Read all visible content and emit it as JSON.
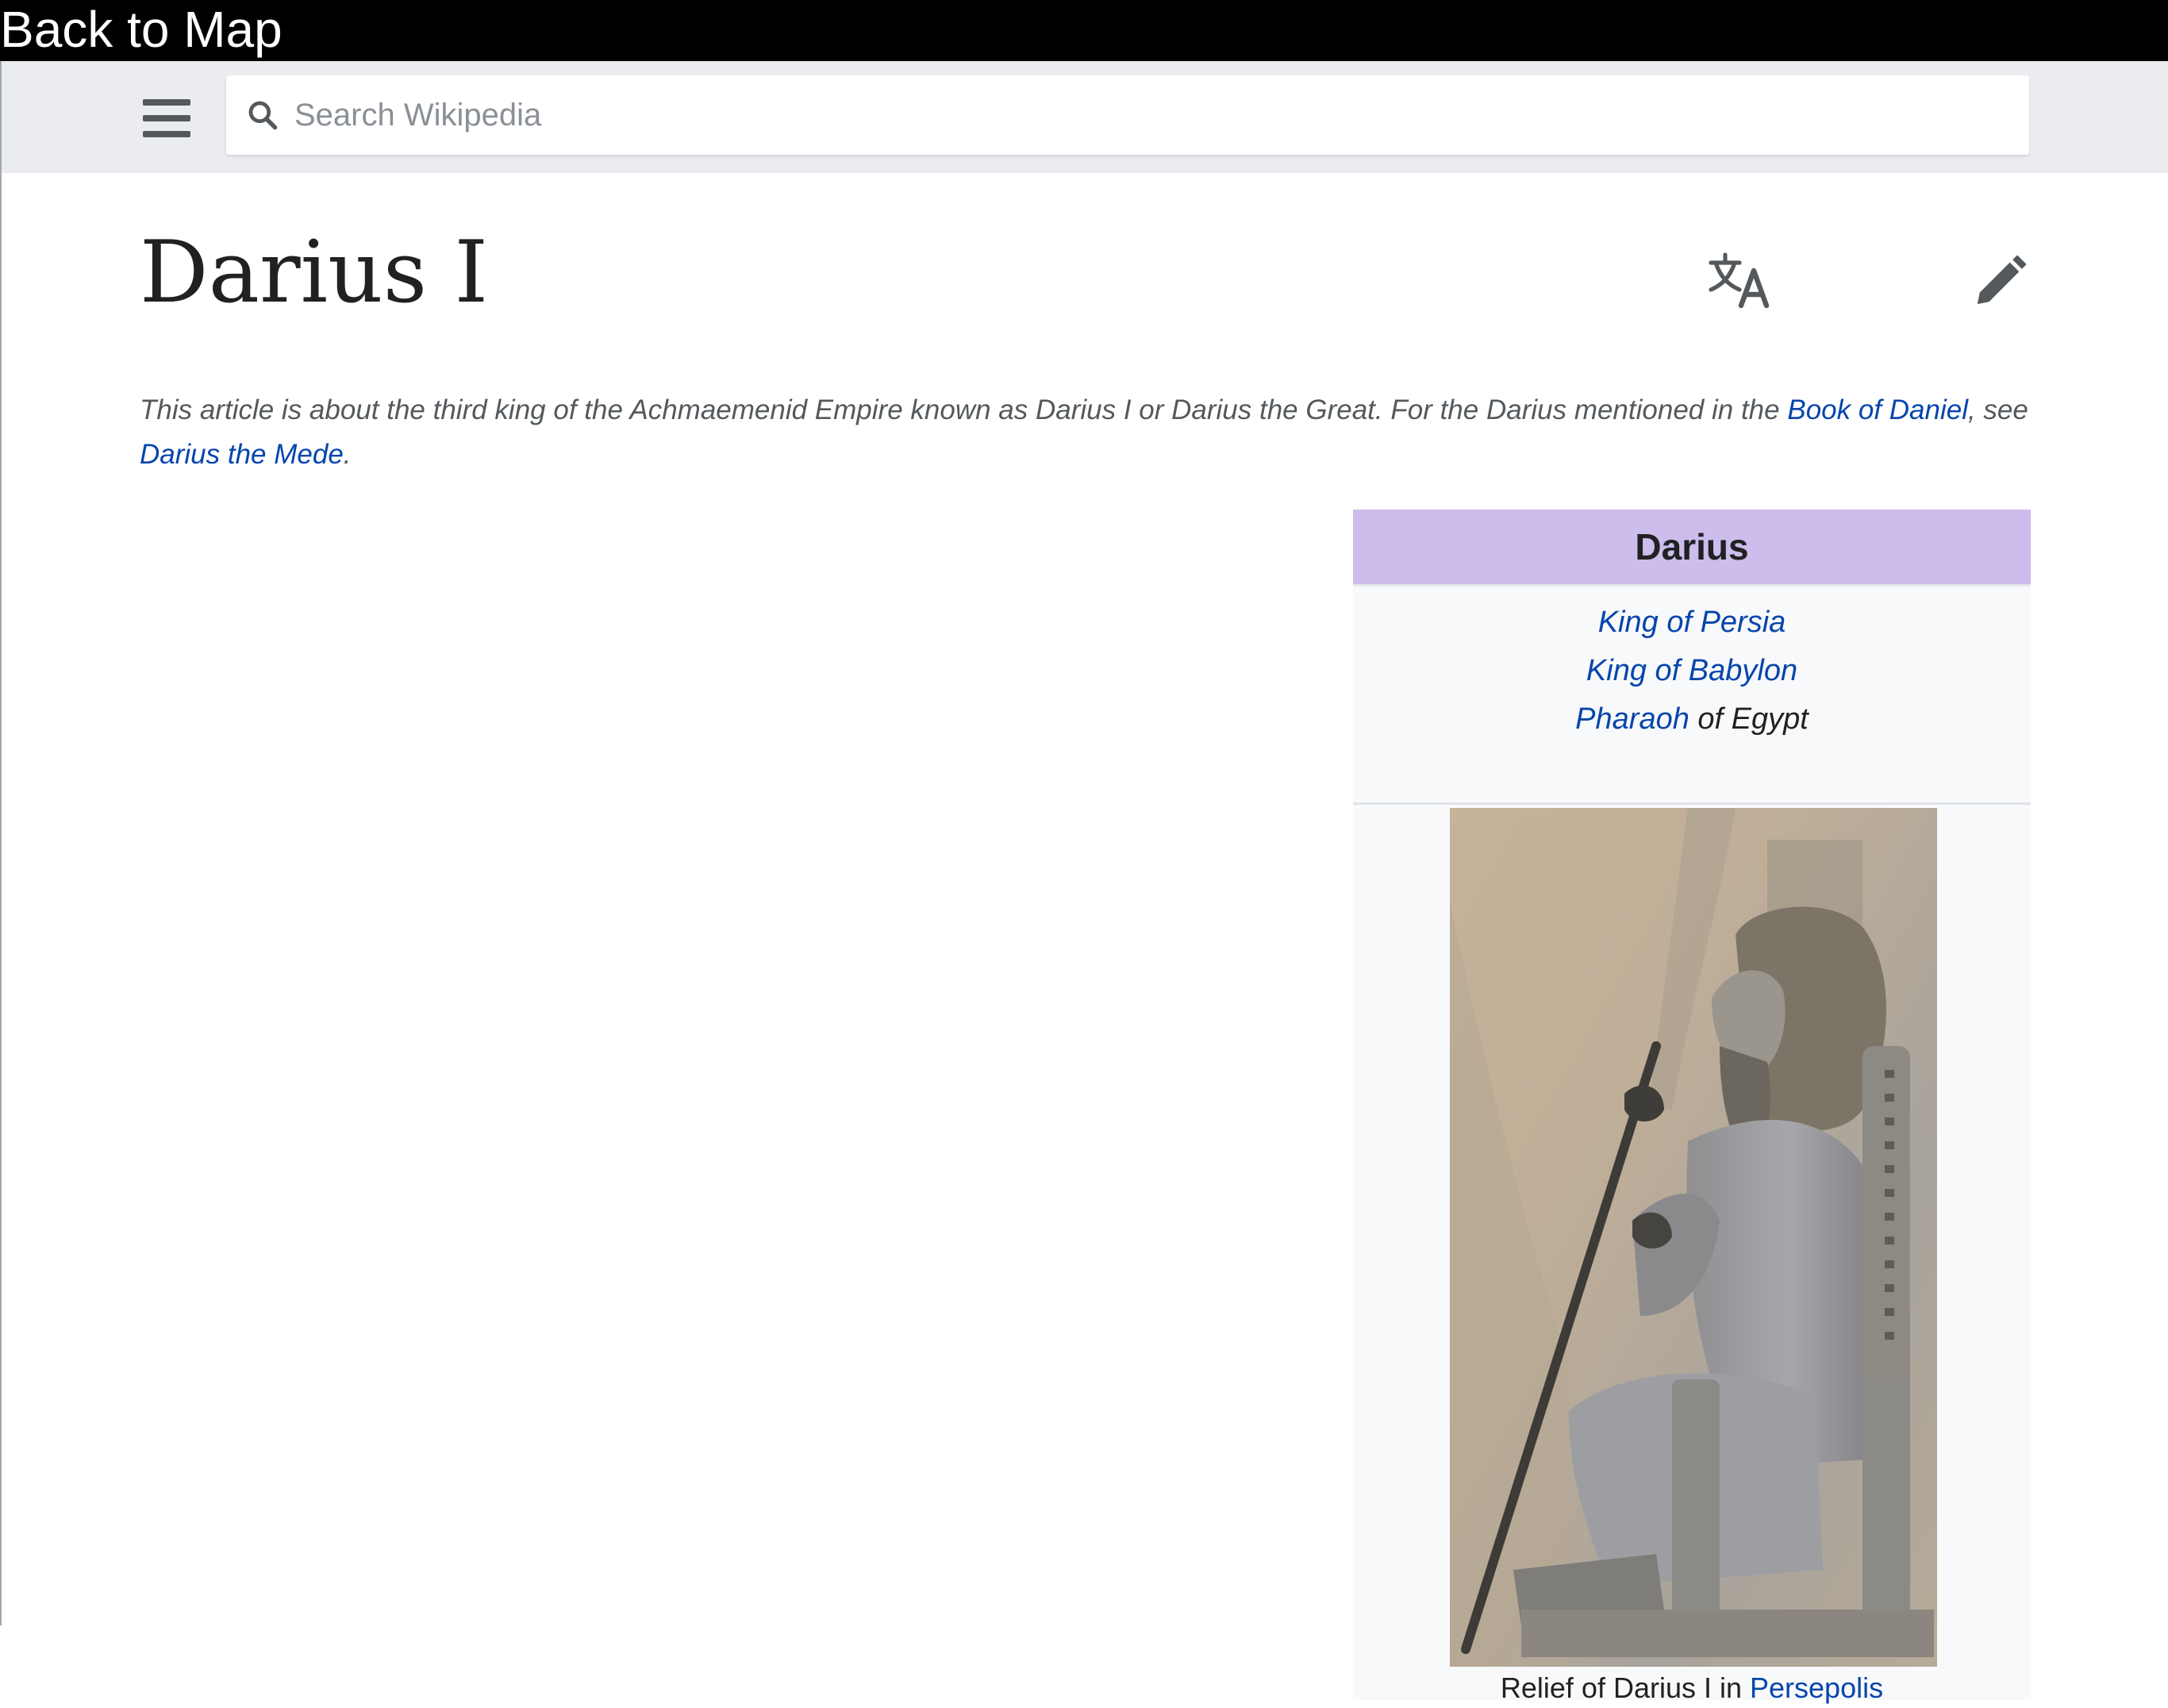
{
  "nav": {
    "back_label": "Back to Map"
  },
  "header": {
    "search_placeholder": "Search Wikipedia",
    "menu_icon": "hamburger-menu-icon",
    "search_icon": "search-icon"
  },
  "article": {
    "title": "Darius I",
    "language_icon": "language-icon",
    "edit_icon": "pencil-icon",
    "hatnote": {
      "text_before": "This article is about the third king of the Achmaemenid Empire known as Darius I or Darius the Great. For the Darius mentioned in the ",
      "link1": "Book of Daniel",
      "text_middle": ", see ",
      "link2": "Darius the Mede",
      "text_after": "."
    }
  },
  "infobox": {
    "title": "Darius",
    "title_color": "#ccbdec",
    "titles": {
      "line1_link": "King of Persia",
      "line2_link": "King of Babylon",
      "line3_link": "Pharaoh",
      "line3_text": " of Egypt"
    },
    "caption": {
      "text": "Relief of Darius I in ",
      "link": "Persepolis"
    }
  },
  "colors": {
    "link": "#0645ad",
    "header_bg": "#eaecf0",
    "topbar_bg": "#000000"
  }
}
